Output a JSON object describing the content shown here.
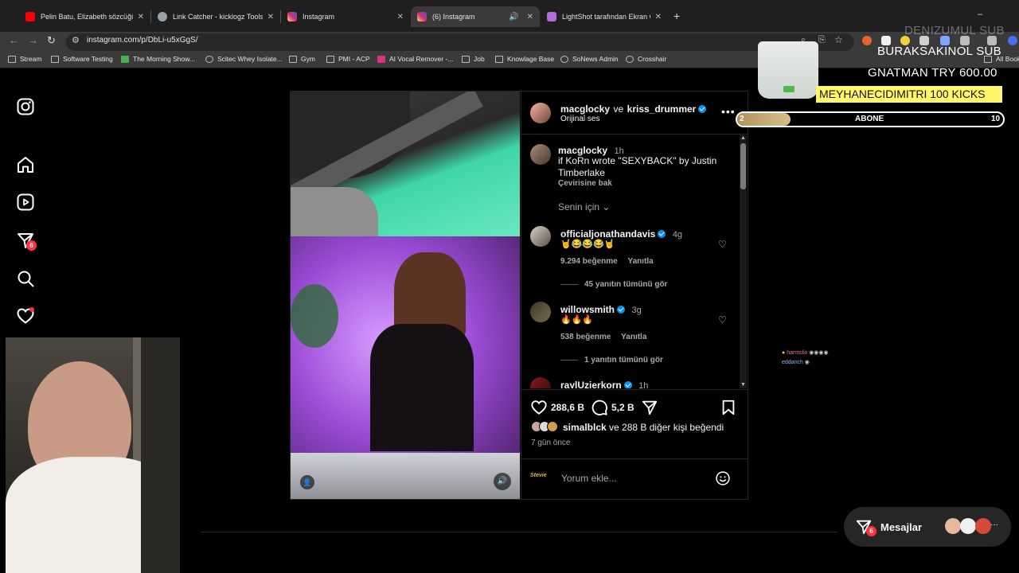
{
  "browser": {
    "tabs": [
      {
        "label": "Pelin Batu, Elizabeth sözcüğünü",
        "icon": "youtube-icon",
        "color": "#ff0000"
      },
      {
        "label": "Link Catcher - kicklogz Tools",
        "icon": "globe-icon",
        "color": "#9aa0a6"
      },
      {
        "label": "Instagram",
        "icon": "instagram-icon",
        "color": "#e1306c"
      },
      {
        "label": "(6) Instagram",
        "icon": "instagram-icon",
        "color": "#e1306c",
        "active": true
      },
      {
        "label": "LightShot tarafından Ekran Görü",
        "icon": "feather-icon",
        "color": "#b36bdc"
      }
    ],
    "url": "instagram.com/p/DbLi-u5xGgS/",
    "bookmarks": [
      {
        "label": "Stream"
      },
      {
        "label": "Software Testing"
      },
      {
        "label": "The Morning Show..."
      },
      {
        "label": "Scitec Whey Isolate..."
      },
      {
        "label": "Gym"
      },
      {
        "label": "PMI - ACP"
      },
      {
        "label": "AI Vocal Remover -..."
      },
      {
        "label": "Job"
      },
      {
        "label": "Knowlage Base"
      },
      {
        "label": "SoNews Admin"
      },
      {
        "label": "Crosshair"
      }
    ],
    "all_bookmarks": "All Book"
  },
  "nav": {
    "notifications_badge": "6"
  },
  "post": {
    "author": "macglocky",
    "joiner": "ve",
    "coauthor": "kriss_drummer",
    "audio": "Orijinal ses",
    "caption_user": "macglocky",
    "caption_time": "1h",
    "caption_text": "if KoRn wrote \"SEXYBACK\" by Justin Timberlake",
    "see_translation": "Çevirisine bak",
    "for_you": "Senin için",
    "comments": [
      {
        "user": "officialjonathandavis",
        "time": "4g",
        "text": "🤘😂😂😂🤘",
        "likes": "9.294 beğenme",
        "reply": "Yanıtla",
        "view_replies": "45 yanıtın tümünü gör"
      },
      {
        "user": "willowsmith",
        "time": "3g",
        "text": "🔥🔥🔥",
        "likes": "538 beğenme",
        "reply": "Yanıtla",
        "view_replies": "1 yanıtın tümünü gör"
      },
      {
        "user": "raylUzierkorn",
        "time": "1h",
        "text": "",
        "likes": "",
        "reply": "",
        "view_replies": ""
      }
    ],
    "like_count": "288,6 B",
    "comment_count": "5,2 B",
    "liked_by_user": "simalblck",
    "liked_by_rest": "ve 288 B diğer kişi beğendi",
    "post_age": "7 gün önce",
    "comment_placeholder": "Yorum ekle..."
  },
  "messages": {
    "label": "Mesajlar",
    "badge": "6"
  },
  "overlay": {
    "line1": "DENIZUMUL SUB",
    "line2": "BURAKSAKINOL SUB",
    "line3": "GNATMAN TRY 600.00",
    "line4": "MEYHANECIDIMITRI 100 KICKS",
    "goal_label": "ABONE",
    "goal_current": "2",
    "goal_target": "10",
    "goal_progress": 0.2,
    "chat_user1": "harmslix",
    "chat_user2": "eddanch"
  }
}
